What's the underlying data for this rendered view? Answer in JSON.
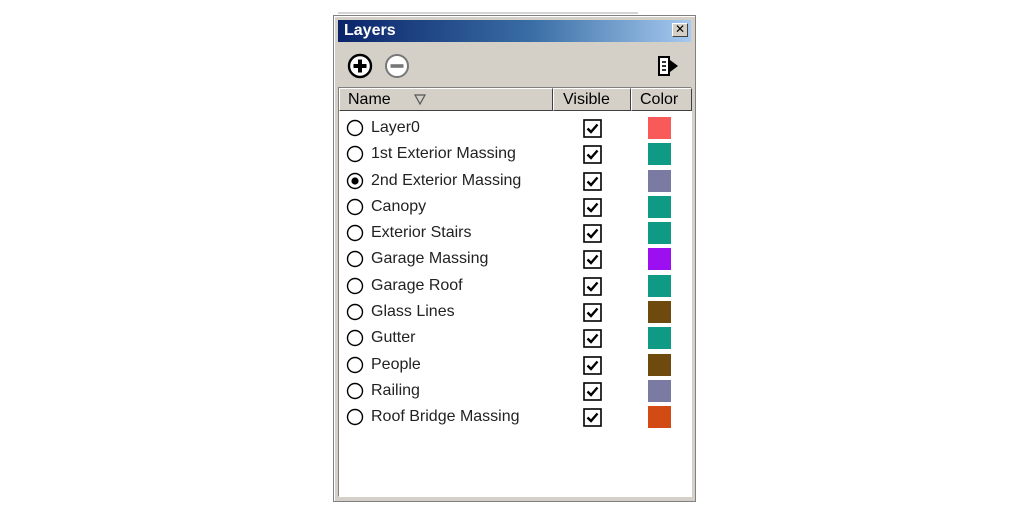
{
  "window": {
    "title": "Layers"
  },
  "toolbar": {
    "add_icon": "plus-circle-icon",
    "remove_icon": "minus-circle-icon",
    "details_icon": "details-arrow-icon"
  },
  "columns": {
    "name": "Name",
    "visible": "Visible",
    "color": "Color",
    "sort_icon": "sort-down-triangle-icon"
  },
  "layers": [
    {
      "name": "Layer0",
      "active": false,
      "visible": true,
      "color": "#f85a5a"
    },
    {
      "name": "1st Exterior Massing",
      "active": false,
      "visible": true,
      "color": "#0f9a86"
    },
    {
      "name": "2nd Exterior Massing",
      "active": true,
      "visible": true,
      "color": "#7a7aa2"
    },
    {
      "name": "Canopy",
      "active": false,
      "visible": true,
      "color": "#0f9a86"
    },
    {
      "name": "Exterior Stairs",
      "active": false,
      "visible": true,
      "color": "#0f9a86"
    },
    {
      "name": "Garage Massing",
      "active": false,
      "visible": true,
      "color": "#9b0ff0"
    },
    {
      "name": "Garage Roof",
      "active": false,
      "visible": true,
      "color": "#0f9a86"
    },
    {
      "name": "Glass Lines",
      "active": false,
      "visible": true,
      "color": "#6e4a0e"
    },
    {
      "name": "Gutter",
      "active": false,
      "visible": true,
      "color": "#0f9a86"
    },
    {
      "name": "People",
      "active": false,
      "visible": true,
      "color": "#6e4a0e"
    },
    {
      "name": "Railing",
      "active": false,
      "visible": true,
      "color": "#7a7aa2"
    },
    {
      "name": "Roof Bridge Massing",
      "active": false,
      "visible": true,
      "color": "#d24a14"
    }
  ]
}
